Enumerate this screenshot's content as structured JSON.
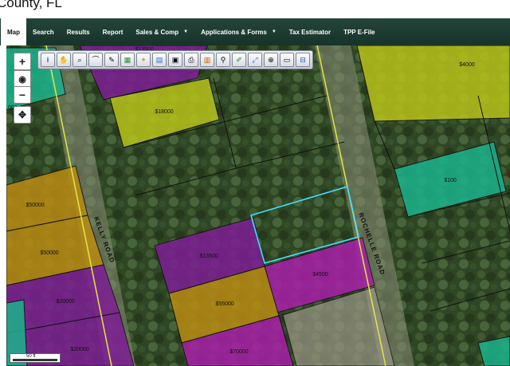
{
  "page_heading": "County, FL",
  "nav": {
    "items": [
      {
        "label": "Map",
        "active": true,
        "dropdown": false
      },
      {
        "label": "Search",
        "active": false,
        "dropdown": false
      },
      {
        "label": "Results",
        "active": false,
        "dropdown": false
      },
      {
        "label": "Report",
        "active": false,
        "dropdown": false
      },
      {
        "label": "Sales & Comp",
        "active": false,
        "dropdown": true
      },
      {
        "label": "Applications & Forms",
        "active": false,
        "dropdown": true
      },
      {
        "label": "Tax Estimator",
        "active": false,
        "dropdown": false
      },
      {
        "label": "TPP E-File",
        "active": false,
        "dropdown": false
      }
    ],
    "colors": {
      "bar": "#1d3b31",
      "active_bg": "#ffffff"
    }
  },
  "map": {
    "roads": [
      "KELLY ROAD",
      "ROCHELLE ROAD"
    ],
    "parcels": [
      {
        "label": "$13500",
        "color": "purple"
      },
      {
        "label": "$18000",
        "color": "yellow"
      },
      {
        "label": "$4000",
        "color": "yellow"
      },
      {
        "label": "$100",
        "color": "teal"
      },
      {
        "label": "$50000",
        "color": "orange"
      },
      {
        "label": "$50000",
        "color": "orange"
      },
      {
        "label": "$13500",
        "color": "purple"
      },
      {
        "label": "$4500",
        "color": "magenta"
      },
      {
        "label": "$20000",
        "color": "purple"
      },
      {
        "label": "$55000",
        "color": "orange"
      },
      {
        "label": "$20000",
        "color": "purple"
      },
      {
        "label": "$70000",
        "color": "magenta"
      },
      {
        "label": "000",
        "color": "teal"
      }
    ],
    "scale_label": "50 ft",
    "colors": {
      "purple": "#7d1e94",
      "magenta": "#a81fa8",
      "yellow": "#b7c21a",
      "orange": "#b98b13",
      "teal": "#1bb38c",
      "selection": "#3ee0ff"
    }
  },
  "toolbar": {
    "tools": [
      "info-icon",
      "identify-icon",
      "zoom-area-icon",
      "measure-icon",
      "draw-pencil-icon",
      "layers-icon",
      "lightbulb-icon",
      "legend-icon",
      "aerial-icon",
      "print-icon",
      "buffer-icon",
      "search-parcel-icon",
      "edit-pencil-icon",
      "full-extent-icon",
      "share-icon",
      "save-icon",
      "export-icon"
    ]
  },
  "map_controls": {
    "zoom_in": "+",
    "zoom_out": "−"
  }
}
